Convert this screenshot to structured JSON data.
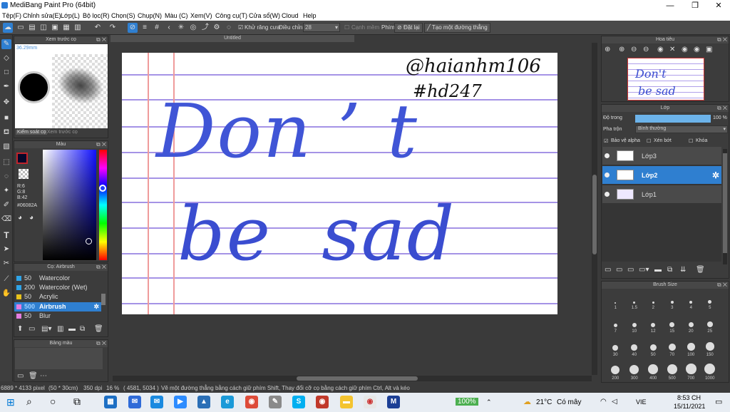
{
  "window": {
    "title": "MediBang Paint Pro (64bit)",
    "minimize": "—",
    "maximize": "❐",
    "close": "✕"
  },
  "menu": [
    "Tệp(F)",
    "Chỉnh sửa(E)",
    "Lớp(L)",
    "Bộ lọc(R)",
    "Chọn(S)",
    "Chụp(N)",
    "Màu (C)",
    "Xem(V)",
    "Công cụ(T)",
    "Cửa sổ(W)",
    "Cloud",
    "Help"
  ],
  "toolbar": {
    "antialias_label": "Khử răng cưa",
    "correction_label": "Điều chỉnh",
    "correction_value": "28",
    "smoothing_label": "Cạnh mềm",
    "key_label": "Phím",
    "reset_label": "Đặt lại",
    "straight_label": "Tạo một đường thẳng"
  },
  "brush_preview": {
    "title": "Xem trước cọ",
    "size": "36.29mm",
    "tab1": "Kiểm soát cọ",
    "tab2": "Xem trước cọ"
  },
  "color_panel": {
    "title": "Màu",
    "r": "R:6",
    "g": "G:8",
    "b": "B:42",
    "hex": "#06082A",
    "fg": "#06082A"
  },
  "brush_panel": {
    "title": "Cọ: Airbrush",
    "items": [
      {
        "size": "50",
        "name": "Watercolor",
        "color": "#2fa4e7",
        "selected": false
      },
      {
        "size": "200",
        "name": "Watercolor (Wet)",
        "color": "#2fa4e7",
        "selected": false
      },
      {
        "size": "50",
        "name": "Acrylic",
        "color": "#e8c21c",
        "selected": false
      },
      {
        "size": "500",
        "name": "Airbrush",
        "color": "#e47de0",
        "selected": true
      },
      {
        "size": "50",
        "name": "Blur",
        "color": "#e47de0",
        "selected": false
      }
    ]
  },
  "palette_panel": {
    "title": "Bảng màu"
  },
  "canvas": {
    "tab": "Untitled",
    "signature1": "@haianhm106",
    "signature2": "#hd247",
    "line1": "Don ’ t",
    "line2": "be  sad"
  },
  "navigator": {
    "title": "Hoa tiêu",
    "thumb1": "Don't",
    "thumb2": "be sad"
  },
  "layer_panel": {
    "title": "Lớp",
    "opacity_label": "Độ trong",
    "opacity_value": "100 %",
    "blend_label": "Pha trộn",
    "blend_value": "Bình thường",
    "protect_alpha": "Bảo vệ alpha",
    "clipping": "Xén bớt",
    "lock": "Khóa",
    "layers": [
      {
        "name": "Lớp3",
        "selected": false
      },
      {
        "name": "Lớp2",
        "selected": true
      },
      {
        "name": "Lớp1",
        "selected": false
      }
    ]
  },
  "brush_size": {
    "title": "Brush Size",
    "sizes": [
      "1",
      "1.5",
      "2",
      "3",
      "4",
      "5",
      "7",
      "10",
      "12",
      "15",
      "20",
      "25",
      "30",
      "40",
      "50",
      "70",
      "100",
      "150",
      "200",
      "300",
      "400",
      "500",
      "700",
      "1000"
    ]
  },
  "status": {
    "dims": "6889 * 4133 pixel",
    "cm": "(50 * 30cm)",
    "dpi": "350 dpi",
    "zoom": "16 %",
    "coords": "( 4581, 5034 )",
    "hint": "Vẽ một đường thẳng bằng cách giữ phím Shift, Thay đổi cỡ cọ bằng cách giữ phím Ctrl, Alt và kéo"
  },
  "taskbar": {
    "battery": "100%",
    "weather": "21°C",
    "weather_desc": "Có mây",
    "lang": "VIE",
    "time": "8:53 CH",
    "date": "15/11/2021"
  }
}
